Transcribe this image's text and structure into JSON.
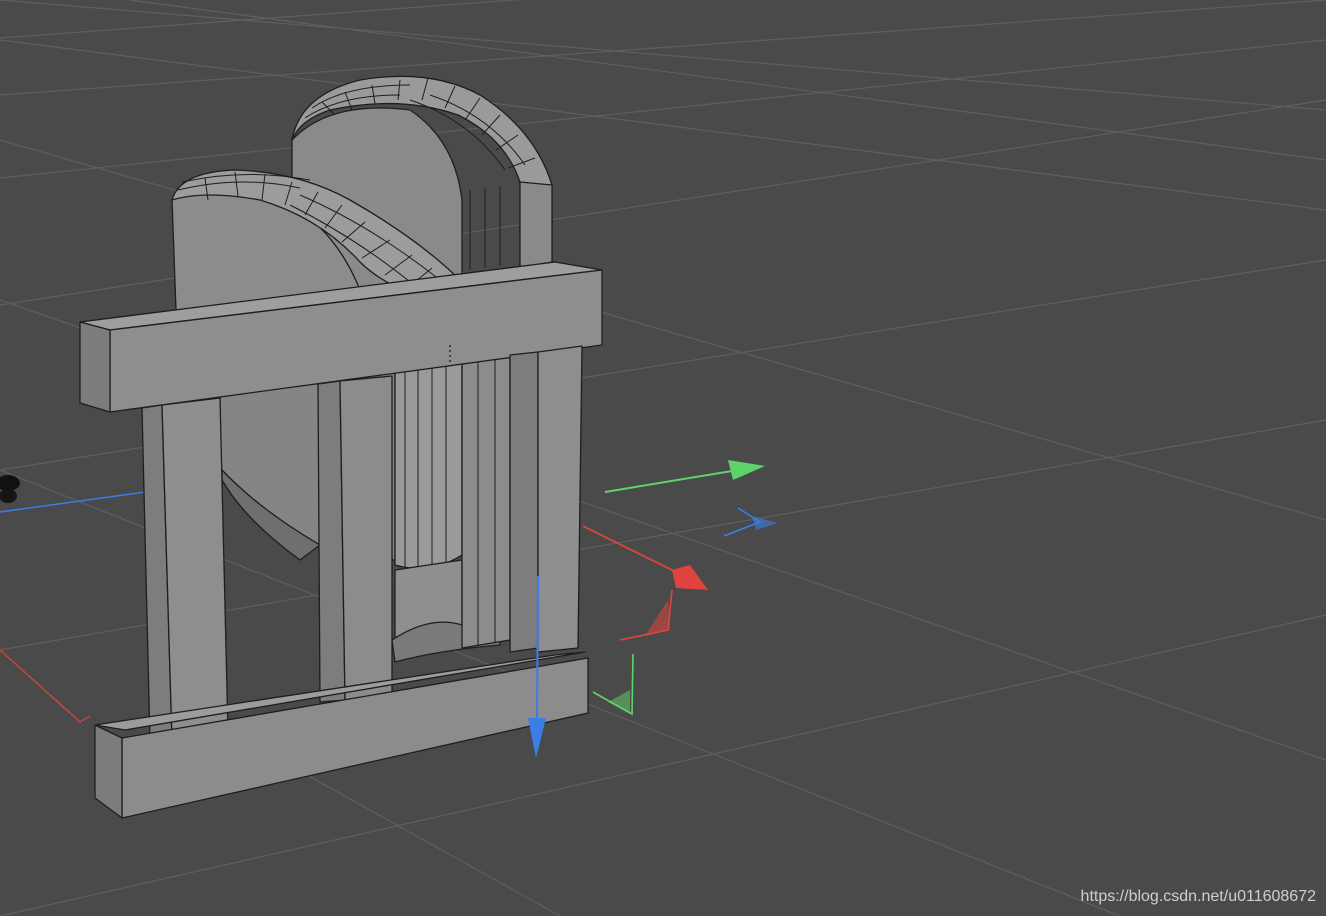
{
  "watermark": "https://blog.csdn.net/u011608672",
  "colors": {
    "background": "#4a4a4a",
    "grid": "#5c5c5c",
    "mesh_face": "#8c8c8c",
    "mesh_face_shadow": "#777777",
    "mesh_edge": "#1e1e1e",
    "axis_x": "#e0443e",
    "axis_y": "#5fd36b",
    "axis_z": "#3a7ee6"
  },
  "viewport": {
    "model_name": "",
    "gizmo": {
      "x_label": "",
      "y_label": "",
      "z_label": ""
    }
  }
}
